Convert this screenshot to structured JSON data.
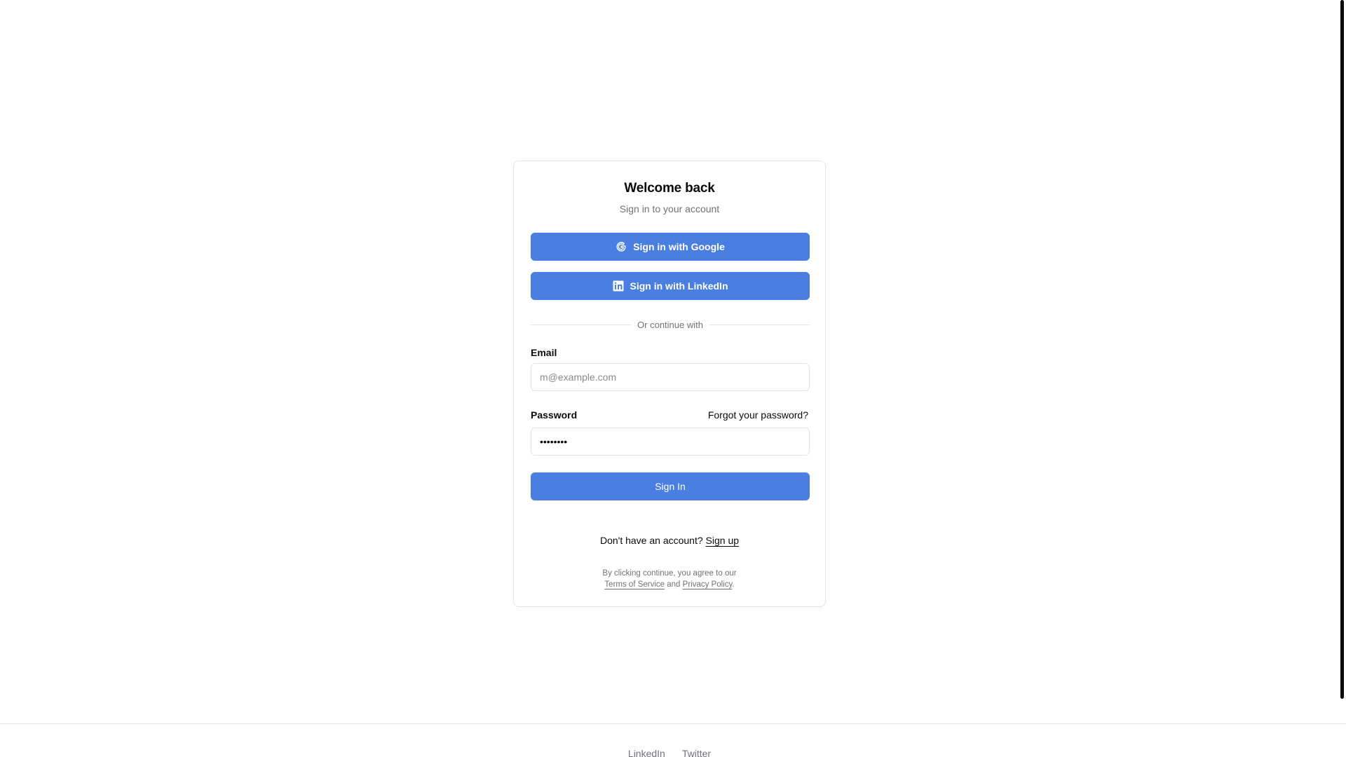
{
  "login_card": {
    "title": "Welcome back",
    "subtitle": "Sign in to your account",
    "google_button_label": "Sign in with Google",
    "linkedin_button_label": "Sign in with LinkedIn",
    "divider_text": "Or continue with",
    "email": {
      "label": "Email",
      "placeholder": "m@example.com",
      "value": ""
    },
    "password": {
      "label": "Password",
      "value": "********",
      "forgot_link": "Forgot your password?"
    },
    "sign_in_button_label": "Sign In",
    "signup_prompt": "Don't have an account?",
    "signup_link": "Sign up",
    "legal": {
      "prefix": "By clicking continue, you agree to our",
      "terms_link": "Terms of Service",
      "conjunction": "and",
      "privacy_link": "Privacy Policy",
      "suffix": "."
    }
  },
  "footer": {
    "links": [
      "LinkedIn",
      "Twitter"
    ]
  },
  "colors": {
    "accent": "#4a7ee0",
    "border": "#e4e4e7",
    "muted_text": "#71717a",
    "text": "#0a0a0a"
  },
  "icons": {
    "google": "google-icon",
    "linkedin": "linkedin-icon"
  }
}
